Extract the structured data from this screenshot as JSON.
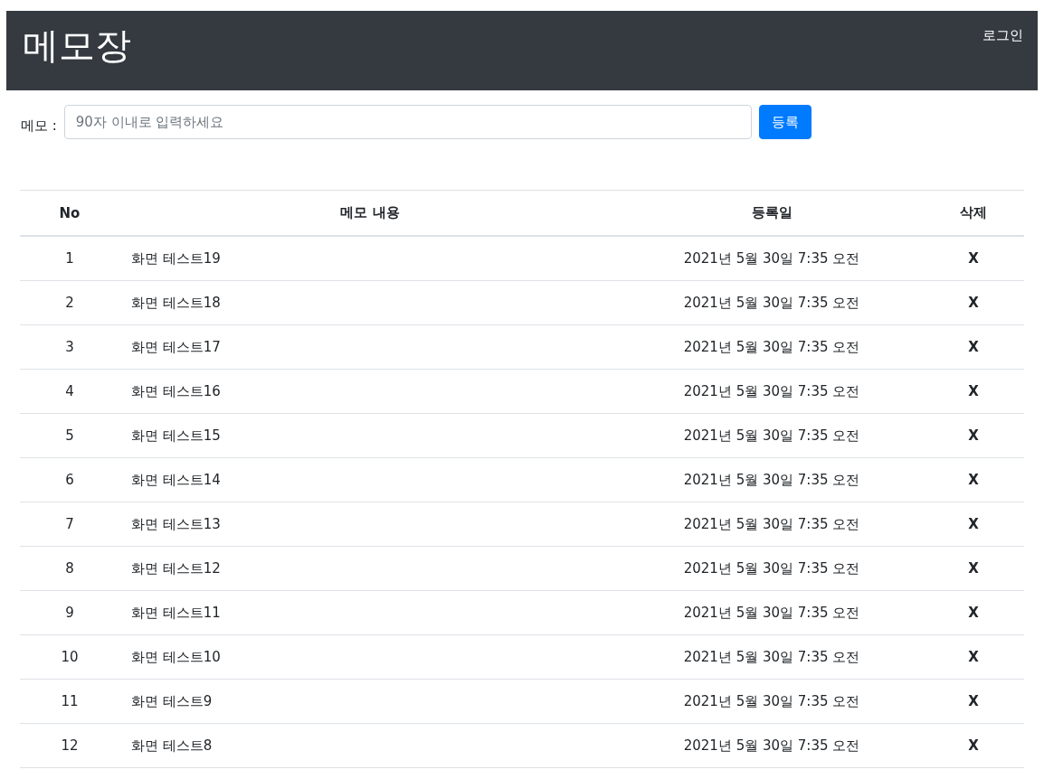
{
  "header": {
    "title": "메모장",
    "login": "로그인"
  },
  "form": {
    "label": "메모 :",
    "placeholder": "90자 이내로 입력하세요",
    "button": "등록"
  },
  "table": {
    "columns": [
      "No",
      "메모 내용",
      "등록일",
      "삭제"
    ],
    "rows": [
      {
        "no": "1",
        "content": "화면 테스트19",
        "date": "2021년 5월 30일 7:35 오전",
        "delete": "X"
      },
      {
        "no": "2",
        "content": "화면 테스트18",
        "date": "2021년 5월 30일 7:35 오전",
        "delete": "X"
      },
      {
        "no": "3",
        "content": "화면 테스트17",
        "date": "2021년 5월 30일 7:35 오전",
        "delete": "X"
      },
      {
        "no": "4",
        "content": "화면 테스트16",
        "date": "2021년 5월 30일 7:35 오전",
        "delete": "X"
      },
      {
        "no": "5",
        "content": "화면 테스트15",
        "date": "2021년 5월 30일 7:35 오전",
        "delete": "X"
      },
      {
        "no": "6",
        "content": "화면 테스트14",
        "date": "2021년 5월 30일 7:35 오전",
        "delete": "X"
      },
      {
        "no": "7",
        "content": "화면 테스트13",
        "date": "2021년 5월 30일 7:35 오전",
        "delete": "X"
      },
      {
        "no": "8",
        "content": "화면 테스트12",
        "date": "2021년 5월 30일 7:35 오전",
        "delete": "X"
      },
      {
        "no": "9",
        "content": "화면 테스트11",
        "date": "2021년 5월 30일 7:35 오전",
        "delete": "X"
      },
      {
        "no": "10",
        "content": "화면 테스트10",
        "date": "2021년 5월 30일 7:35 오전",
        "delete": "X"
      },
      {
        "no": "11",
        "content": "화면 테스트9",
        "date": "2021년 5월 30일 7:35 오전",
        "delete": "X"
      },
      {
        "no": "12",
        "content": "화면 테스트8",
        "date": "2021년 5월 30일 7:35 오전",
        "delete": "X"
      }
    ]
  }
}
